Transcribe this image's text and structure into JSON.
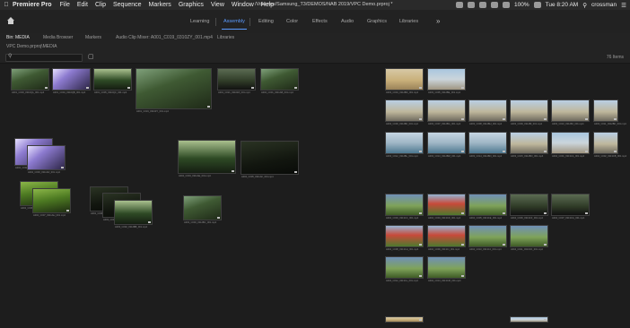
{
  "menubar": {
    "app": "Premiere Pro",
    "items": [
      "File",
      "Edit",
      "Clip",
      "Sequence",
      "Markers",
      "Graphics",
      "View",
      "Window",
      "Help"
    ],
    "path": "/Volumes/Samsung_T3/DEMOS/NAB 2019/VPC Demo.prproj *",
    "battery": "100%",
    "clock": "Tue 8:20 AM",
    "user": "crossman"
  },
  "workspaces": {
    "items": [
      "Learning",
      "Assembly",
      "Editing",
      "Color",
      "Effects",
      "Audio",
      "Graphics",
      "Libraries"
    ],
    "active": "Assembly",
    "more": "»"
  },
  "panel": {
    "tabs": [
      "Bin: MEDIA",
      "Media Browser",
      "Markers",
      "Audio Clip Mixer: A001_C019_0310ZY_001.mp4",
      "Libraries"
    ],
    "breadcrumb": "VPC Demo.prproj\\MEDIA",
    "item_count": "76 Items"
  },
  "colors": {
    "accent": "#5b9bff",
    "panel_bg": "#1d1d1d"
  },
  "clips": [
    {
      "caption": "A001_C003_0310QA_001.mp4"
    },
    {
      "caption": "A001_C004_0310QB_001.mp4"
    },
    {
      "caption": "A001_C005_0310QC_001.mp4"
    },
    {
      "caption": "A001_C019_0310ZY_001.mp4"
    },
    {
      "caption": "A001_C021_0310ZZ_001.mp4"
    },
    {
      "caption": "A002_C001_0311AB_001.mp4"
    },
    {
      "caption": "A002_C002_0311AC_001.mp4"
    },
    {
      "caption": "A002_C003_0311AD_001.mp4"
    },
    {
      "caption": "A002_C004_0311AE_001.mp4"
    },
    {
      "caption": "A002_C005_0311AF_001.mp4"
    },
    {
      "caption": "A002_C006_0311AG_001.mp4"
    },
    {
      "caption": "A002_C007_0311AH_001.mp4"
    },
    {
      "caption": "A002_C008_0311AI_001.mp4"
    },
    {
      "caption": "A003_C001_0312BA_001.mp4"
    },
    {
      "caption": "A003_C002_0312BB_001.mp4"
    },
    {
      "caption": "A003_C003_0312BC_001.mp4"
    },
    {
      "caption": "A003_C004_0312BD_001.mp4"
    },
    {
      "caption": "A003_C005_0312BE_001.mp4"
    },
    {
      "caption": "A003_C006_0312BF_001.mp4"
    },
    {
      "caption": "A003_C007_0312BG_001.mp4"
    },
    {
      "caption": "A003_C008_0312BH_001.mp4"
    },
    {
      "caption": "A003_C009_0312BI_001.mp4"
    },
    {
      "caption": "A003_C010_0312BJ_001.mp4"
    },
    {
      "caption": "A003_C011_0312BK_001.mp4"
    },
    {
      "caption": "A003_C012_0312BL_001.mp4"
    },
    {
      "caption": "A003_C013_0312BM_001.mp4"
    },
    {
      "caption": "A003_C014_0312BN_001.mp4"
    },
    {
      "caption": "A003_C015_0312BO_001.mp4"
    },
    {
      "caption": "A004_C001_0313CA_001.mp4"
    },
    {
      "caption": "A004_C002_0313CB_001.mp4"
    },
    {
      "caption": "A004_C003_0313CC_001.mp4"
    },
    {
      "caption": "A004_C004_0313CD_001.mp4"
    },
    {
      "caption": "A004_C005_0313CE_001.mp4"
    },
    {
      "caption": "A004_C006_0313CF_001.mp4"
    },
    {
      "caption": "A004_C007_0313CG_001.mp4"
    },
    {
      "caption": "A004_C008_0313CH_001.mp4"
    },
    {
      "caption": "A004_C009_0313CI_001.mp4"
    },
    {
      "caption": "A004_C010_0313CJ_001.mp4"
    },
    {
      "caption": "A004_C011_0313CK_001.mp4"
    },
    {
      "caption": "A004_C012_0313CL_001.mp4"
    },
    {
      "caption": "A004_C013_0313CM_001.mp4"
    },
    {
      "caption": "A004_C014_0313CN_001.mp4"
    },
    {
      "caption": "A004_C015_0313CO_001.mp4"
    }
  ]
}
